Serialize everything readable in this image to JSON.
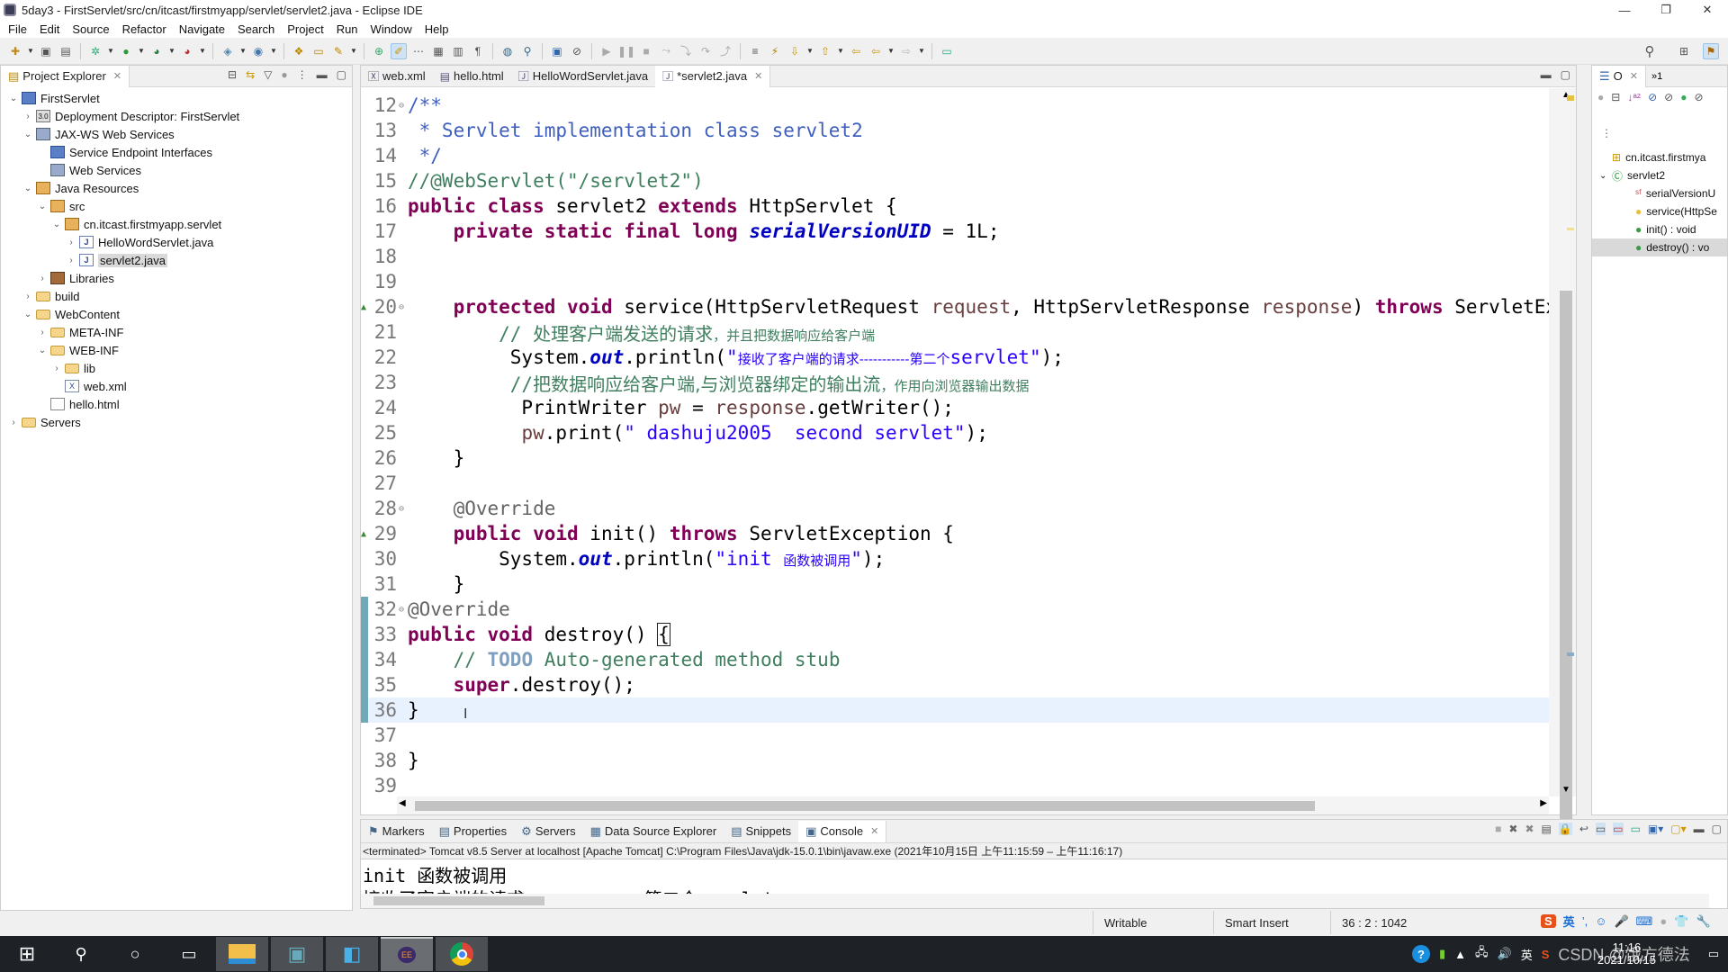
{
  "window": {
    "title": "5day3 - FirstServlet/src/cn/itcast/firstmyapp/servlet/servlet2.java - Eclipse IDE",
    "controls": {
      "minimize": "—",
      "restore": "❐",
      "close": "✕"
    }
  },
  "menubar": [
    "File",
    "Edit",
    "Source",
    "Refactor",
    "Navigate",
    "Search",
    "Project",
    "Run",
    "Window",
    "Help"
  ],
  "explorer": {
    "title": "Project Explorer",
    "close": "✕",
    "tree": [
      {
        "label": "FirstServlet",
        "depth": 0,
        "twisty": "open",
        "icon": "project-icon"
      },
      {
        "label": "Deployment Descriptor: FirstServlet",
        "depth": 1,
        "twisty": "closed",
        "icon": "deployment-descriptor-icon"
      },
      {
        "label": "JAX-WS Web Services",
        "depth": 1,
        "twisty": "open",
        "icon": "web-services-icon"
      },
      {
        "label": "Service Endpoint Interfaces",
        "depth": 2,
        "twisty": "none",
        "icon": "interface-icon"
      },
      {
        "label": "Web Services",
        "depth": 2,
        "twisty": "none",
        "icon": "web-services-icon"
      },
      {
        "label": "Java Resources",
        "depth": 1,
        "twisty": "open",
        "icon": "java-resources-icon"
      },
      {
        "label": "src",
        "depth": 2,
        "twisty": "open",
        "icon": "source-folder-icon"
      },
      {
        "label": "cn.itcast.firstmyapp.servlet",
        "depth": 3,
        "twisty": "open",
        "icon": "package-icon"
      },
      {
        "label": "HelloWordServlet.java",
        "depth": 4,
        "twisty": "closed",
        "icon": "java-file-icon"
      },
      {
        "label": "servlet2.java",
        "depth": 4,
        "twisty": "closed",
        "icon": "java-file-icon",
        "selected": true
      },
      {
        "label": "Libraries",
        "depth": 2,
        "twisty": "closed",
        "icon": "library-icon"
      },
      {
        "label": "build",
        "depth": 1,
        "twisty": "closed",
        "icon": "folder-icon"
      },
      {
        "label": "WebContent",
        "depth": 1,
        "twisty": "open",
        "icon": "folder-icon"
      },
      {
        "label": "META-INF",
        "depth": 2,
        "twisty": "closed",
        "icon": "folder-icon"
      },
      {
        "label": "WEB-INF",
        "depth": 2,
        "twisty": "open",
        "icon": "folder-icon"
      },
      {
        "label": "lib",
        "depth": 3,
        "twisty": "closed",
        "icon": "folder-icon"
      },
      {
        "label": "web.xml",
        "depth": 3,
        "twisty": "none",
        "icon": "xml-file-icon"
      },
      {
        "label": "hello.html",
        "depth": 2,
        "twisty": "none",
        "icon": "html-file-icon"
      },
      {
        "label": "Servers",
        "depth": 0,
        "twisty": "closed",
        "icon": "servers-folder-icon"
      }
    ]
  },
  "editor": {
    "tabs": [
      {
        "label": "web.xml",
        "icon": "xml-file-icon"
      },
      {
        "label": "hello.html",
        "icon": "html-file-icon"
      },
      {
        "label": "HelloWordServlet.java",
        "icon": "java-file-icon"
      },
      {
        "label": "*servlet2.java",
        "icon": "java-file-icon",
        "active": true
      }
    ],
    "current_line": 36,
    "lines": [
      {
        "n": "12",
        "mark": "fold",
        "tokens": [
          [
            "jd",
            "/**"
          ]
        ]
      },
      {
        "n": "13",
        "tokens": [
          [
            "jd",
            " * Servlet implementation class servlet2"
          ]
        ]
      },
      {
        "n": "14",
        "tokens": [
          [
            "jd",
            " */"
          ]
        ]
      },
      {
        "n": "15",
        "tokens": [
          [
            "cm",
            "//@WebServlet(\"/servlet2\")"
          ]
        ]
      },
      {
        "n": "16",
        "tokens": [
          [
            "kw",
            "public class "
          ],
          [
            "",
            "servlet2 "
          ],
          [
            "kw",
            "extends "
          ],
          [
            "",
            "HttpServlet {"
          ]
        ]
      },
      {
        "n": "17",
        "tokens": [
          [
            "",
            "    "
          ],
          [
            "kw",
            "private static final long "
          ],
          [
            "fld",
            "serialVersionUID"
          ],
          [
            "",
            " = 1L;"
          ]
        ]
      },
      {
        "n": "18",
        "tokens": []
      },
      {
        "n": "19",
        "tokens": []
      },
      {
        "n": "20",
        "mark": "override-fold",
        "tokens": [
          [
            "",
            "    "
          ],
          [
            "kw",
            "protected void "
          ],
          [
            "",
            "service(HttpServletRequest "
          ],
          [
            "prm",
            "request"
          ],
          [
            "",
            ", HttpServletResponse "
          ],
          [
            "prm",
            "response"
          ],
          [
            ") ",
            ""
          ],
          [
            "kw",
            "throws "
          ],
          [
            "",
            "ServletException"
          ]
        ]
      },
      {
        "n": "21",
        "tokens": [
          [
            "cm",
            "        // "
          ],
          [
            "cm cjkbig",
            "处理客户端发送的请求"
          ],
          [
            "cm cjk",
            "，并且把数据响应给客户端"
          ]
        ]
      },
      {
        "n": "22",
        "tokens": [
          [
            "",
            "         System."
          ],
          [
            "fld",
            "out"
          ],
          [
            "",
            ".println("
          ],
          [
            "str",
            "\""
          ],
          [
            "str cjk",
            "接收了客户端的请求-----------第二个"
          ],
          [
            "str",
            "servlet\""
          ],
          [
            "",
            ");"
          ]
        ]
      },
      {
        "n": "23",
        "tokens": [
          [
            "cm",
            "         //"
          ],
          [
            "cm cjkbig",
            "把数据响应给客户端,与浏览器绑定的输出流"
          ],
          [
            "cm cjk",
            "，作用向浏览器输出数据"
          ]
        ]
      },
      {
        "n": "24",
        "tokens": [
          [
            "",
            "          PrintWriter "
          ],
          [
            "prm",
            "pw"
          ],
          [
            "",
            " = "
          ],
          [
            "prm",
            "response"
          ],
          [
            "",
            ".getWriter();"
          ]
        ]
      },
      {
        "n": "25",
        "tokens": [
          [
            "",
            "          "
          ],
          [
            "prm",
            "pw"
          ],
          [
            "",
            ".print("
          ],
          [
            "str",
            "\" dashuju2005  second servlet\""
          ],
          [
            "",
            ");"
          ]
        ]
      },
      {
        "n": "26",
        "tokens": [
          [
            "",
            "    }"
          ]
        ]
      },
      {
        "n": "27",
        "tokens": []
      },
      {
        "n": "28",
        "mark": "fold",
        "tokens": [
          [
            "",
            "    "
          ],
          [
            "ann",
            "@Override"
          ]
        ]
      },
      {
        "n": "29",
        "mark": "override",
        "tokens": [
          [
            "",
            "    "
          ],
          [
            "kw",
            "public void "
          ],
          [
            "",
            "init() "
          ],
          [
            "kw",
            "throws "
          ],
          [
            "",
            "ServletException {"
          ]
        ]
      },
      {
        "n": "30",
        "tokens": [
          [
            "",
            "        System."
          ],
          [
            "fld",
            "out"
          ],
          [
            "",
            ".println("
          ],
          [
            "str",
            "\"init "
          ],
          [
            "str cjk",
            "函数被调用"
          ],
          [
            "str",
            "\""
          ],
          [
            "",
            ");"
          ]
        ]
      },
      {
        "n": "31",
        "tokens": [
          [
            "",
            "    }"
          ]
        ]
      },
      {
        "n": "32",
        "mark": "fold",
        "tokens": [
          [
            "ann",
            "@Override"
          ]
        ]
      },
      {
        "n": "33",
        "mark": "override",
        "tokens": [
          [
            "kw",
            "public void "
          ],
          [
            "",
            "destroy() "
          ],
          [
            "bracket",
            "{"
          ]
        ]
      },
      {
        "n": "34",
        "mark": "task",
        "tokens": [
          [
            "cm",
            "    // "
          ],
          [
            "todo",
            "TODO"
          ],
          [
            "cm",
            " Auto-generated method stub"
          ]
        ]
      },
      {
        "n": "35",
        "tokens": [
          [
            "",
            "    "
          ],
          [
            "kw",
            "super"
          ],
          [
            "",
            ".destroy();"
          ]
        ]
      },
      {
        "n": "36",
        "tokens": [
          [
            "",
            "}"
          ]
        ]
      },
      {
        "n": "37",
        "tokens": []
      },
      {
        "n": "38",
        "tokens": [
          [
            "",
            "}"
          ]
        ]
      },
      {
        "n": "39",
        "tokens": []
      }
    ]
  },
  "outline": {
    "title": "O",
    "overflow": "»1",
    "items": [
      {
        "label": "cn.itcast.firstmya",
        "icon": "package-icon",
        "depth": 0
      },
      {
        "label": "servlet2",
        "icon": "class-icon",
        "depth": 0,
        "twisty": "open"
      },
      {
        "label": "serialVersionU",
        "icon": "static-final-field-icon",
        "depth": 1
      },
      {
        "label": "service(HttpSe",
        "icon": "protected-method-icon",
        "depth": 1
      },
      {
        "label": "init() : void",
        "icon": "public-method-icon",
        "depth": 1
      },
      {
        "label": "destroy() : vo",
        "icon": "public-method-icon",
        "depth": 1,
        "selected": true
      }
    ]
  },
  "bottom_panel": {
    "tabs": [
      {
        "label": "Markers",
        "icon": "markers-icon"
      },
      {
        "label": "Properties",
        "icon": "properties-icon"
      },
      {
        "label": "Servers",
        "icon": "servers-icon"
      },
      {
        "label": "Data Source Explorer",
        "icon": "data-source-icon"
      },
      {
        "label": "Snippets",
        "icon": "snippets-icon"
      },
      {
        "label": "Console",
        "icon": "console-icon",
        "active": true
      }
    ],
    "console_info": "<terminated> Tomcat v8.5 Server at localhost [Apache Tomcat] C:\\Program Files\\Java\\jdk-15.0.1\\bin\\javaw.exe  (2021年10月15日 上午11:15:59 – 上午11:16:17)",
    "output": [
      "init 函数被调用",
      "接收了客户端的请求-----------第二个servlet"
    ]
  },
  "statusbar": {
    "writable": "Writable",
    "insert_mode": "Smart Insert",
    "position": "36 : 2 : 1042"
  },
  "taskbar": {
    "apps": [
      "File Explorer",
      "Control Panel",
      "Task Manager",
      "Eclipse Java EE IDE",
      "Google Chrome"
    ],
    "active_app": "Eclipse Java EE IDE",
    "tray": {
      "ime": "英",
      "time": "11:16",
      "date": "2021/10/15",
      "watermark": "CSDN @饿方德法"
    }
  },
  "colors": {
    "keyword": "#7f0055",
    "comment": "#3f7f5f",
    "javadoc": "#3f5fbf",
    "string": "#2a00ff",
    "field": "#0000c0",
    "current_line": "#e8f2fe"
  }
}
